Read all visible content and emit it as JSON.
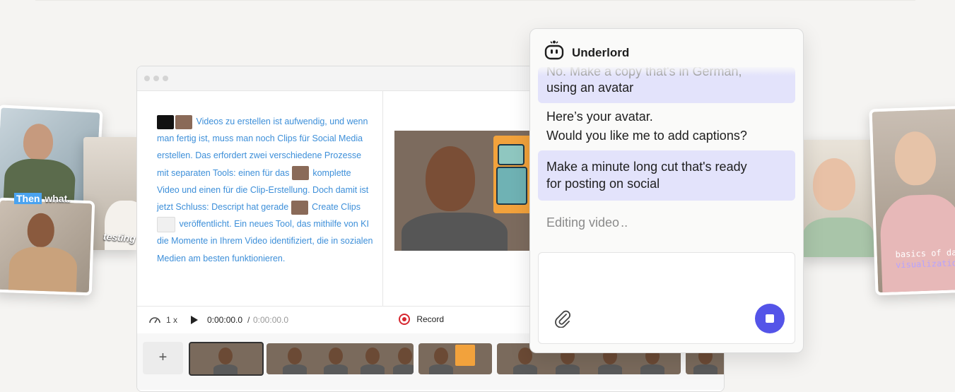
{
  "colors": {
    "accent": "#5454e8",
    "link_text": "#3d8fd9",
    "bubble": "#e3e3fb",
    "record": "#d6262e"
  },
  "left_cards": {
    "caption_then": "Then",
    "caption_what": "what.",
    "caption_testing": "testing"
  },
  "right_cards": {
    "code_line1": "basics of da",
    "code_line2": "visualizatio"
  },
  "script": {
    "seg1": "Videos zu erstellen ist aufwendig, und wenn man fertig ist, muss man noch Clips für Social Media erstellen. Das erfordert zwei verschiedene Prozesse mit separaten Tools: einen für das",
    "seg2": "komplette Video und einen für die Clip-Erstellung. Doch damit ist jetzt Schluss: Descript hat gerade",
    "seg3": "Create Clips",
    "seg4": "veröffentlicht. Ein neues Tool, das mithilfe von KI die Momente in Ihrem Video identifiziert, die in sozialen Medien am besten funktionieren."
  },
  "transport": {
    "speed": "1 x",
    "current_time": "0:00:00.0",
    "separator": "/",
    "total_time": "0:00:00.0",
    "record_label": "Record"
  },
  "timeline": {
    "add_label": "+"
  },
  "chat": {
    "title": "Underlord",
    "icon": "robot-icon",
    "user_msg1_partial": "No. Make a copy that's in German,",
    "user_msg1_line2": "using an avatar",
    "bot_line1": "Here’s your avatar.",
    "bot_line2": "Would you like me to add captions?",
    "user_msg2_line1": "Make a minute long cut that's ready",
    "user_msg2_line2": "for posting on social",
    "status": "Editing video",
    "status_dots": ".."
  }
}
